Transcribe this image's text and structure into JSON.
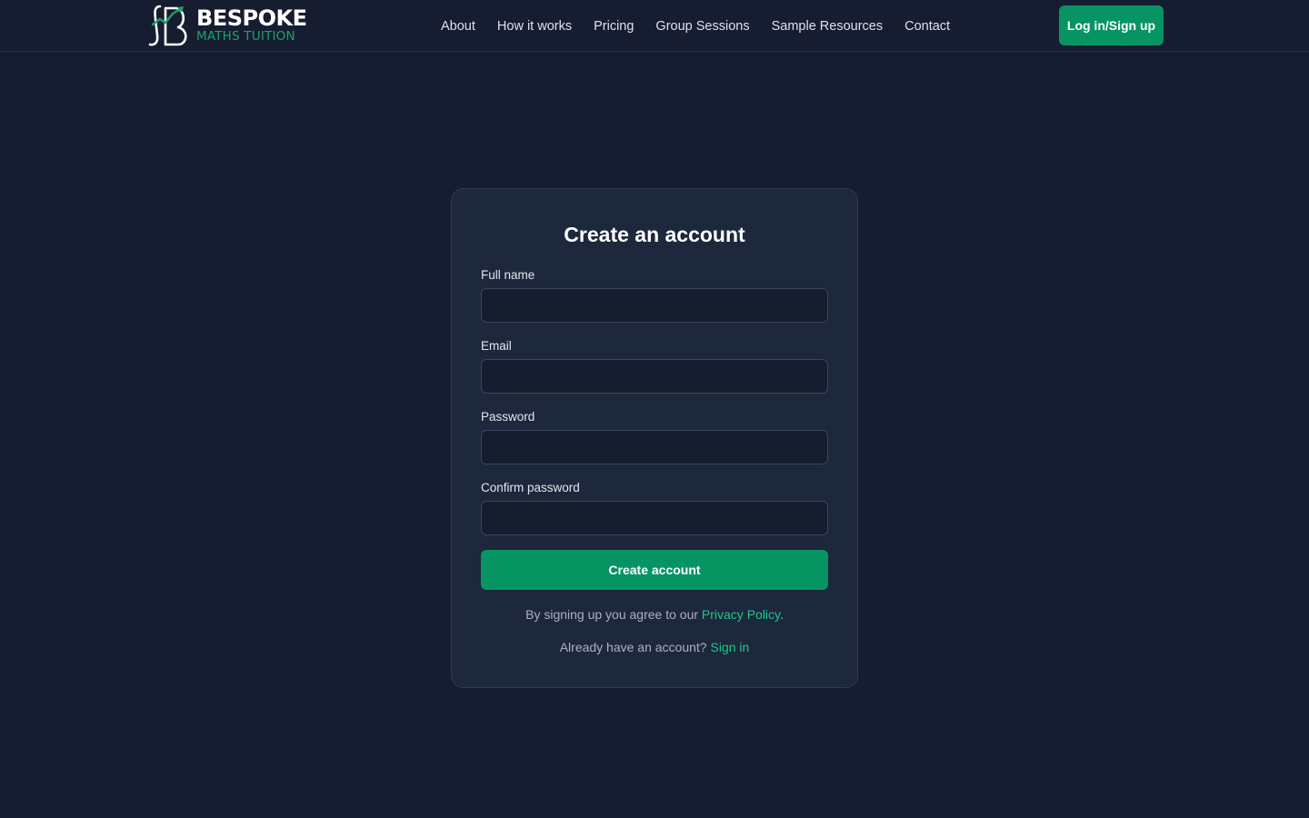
{
  "header": {
    "logo": {
      "brand": "BESPOKE",
      "subtitle": "MATHS TUITION"
    },
    "nav": [
      {
        "label": "About"
      },
      {
        "label": "How it works"
      },
      {
        "label": "Pricing"
      },
      {
        "label": "Group Sessions"
      },
      {
        "label": "Sample Resources"
      },
      {
        "label": "Contact"
      }
    ],
    "login_label": "Log in/Sign up"
  },
  "signup": {
    "title": "Create an account",
    "fields": [
      {
        "label": "Full name",
        "value": ""
      },
      {
        "label": "Email",
        "value": ""
      },
      {
        "label": "Password",
        "value": ""
      },
      {
        "label": "Confirm password",
        "value": ""
      }
    ],
    "submit_label": "Create account",
    "privacy": {
      "prefix": "By signing up you agree to our ",
      "link": "Privacy Policy",
      "suffix": "."
    },
    "signin": {
      "prefix": "Already have an account? ",
      "link": "Sign in"
    }
  },
  "colors": {
    "background": "#171d30",
    "card": "#1d283c",
    "accent": "#069463",
    "link": "#19c98a"
  },
  "icons": {
    "logo": "integral-chart-logo-icon"
  }
}
